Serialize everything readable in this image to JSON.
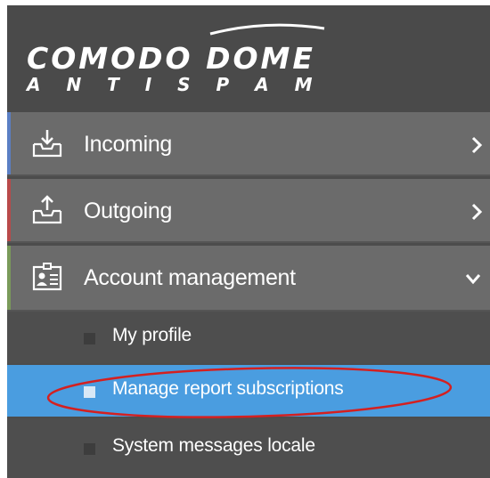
{
  "brand": {
    "line1": "COMODO DOME",
    "line2": "A N T I S P A M"
  },
  "nav": {
    "items": [
      {
        "label": "Incoming",
        "icon": "inbox-download-icon",
        "accent": "#5b7fc4",
        "state": "collapsed"
      },
      {
        "label": "Outgoing",
        "icon": "outbox-upload-icon",
        "accent": "#b94a4a",
        "state": "collapsed"
      },
      {
        "label": "Account management",
        "icon": "id-card-icon",
        "accent": "#7a9a5a",
        "state": "expanded"
      }
    ],
    "sub_items": [
      {
        "label": "My profile",
        "active": false
      },
      {
        "label": "Manage report subscriptions",
        "active": true
      },
      {
        "label": "System messages locale",
        "active": false
      }
    ]
  },
  "colors": {
    "panel_bg": "#4c4c4c",
    "nav_item_bg": "#6b6b6b",
    "active_bg": "#4a9de0",
    "annotation_ellipse": "#d42020"
  }
}
